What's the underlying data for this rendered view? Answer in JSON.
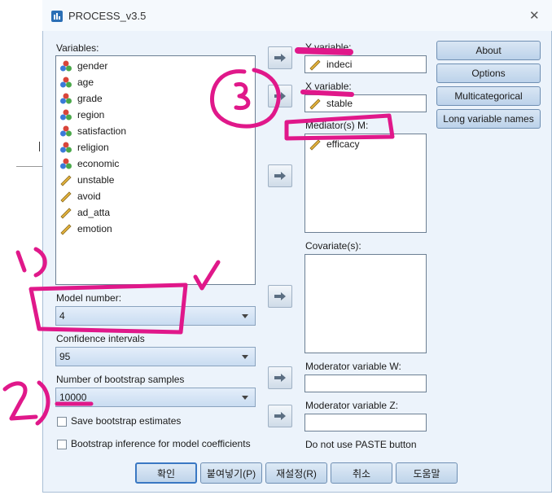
{
  "window": {
    "title": "PROCESS_v3.5",
    "close_glyph": "✕"
  },
  "variables": {
    "label": "Variables:",
    "items": [
      {
        "name": "gender",
        "icon": "nominal-icon"
      },
      {
        "name": "age",
        "icon": "nominal-icon"
      },
      {
        "name": "grade",
        "icon": "nominal-icon"
      },
      {
        "name": "region",
        "icon": "nominal-icon"
      },
      {
        "name": "satisfaction",
        "icon": "nominal-icon"
      },
      {
        "name": "religion",
        "icon": "nominal-icon"
      },
      {
        "name": "economic",
        "icon": "nominal-icon"
      },
      {
        "name": "unstable",
        "icon": "scale-icon"
      },
      {
        "name": "avoid",
        "icon": "scale-icon"
      },
      {
        "name": "ad_atta",
        "icon": "scale-icon"
      },
      {
        "name": "emotion",
        "icon": "scale-icon"
      }
    ]
  },
  "targets": {
    "y_label": "Y variable:",
    "y_value": "indeci",
    "x_label": "X variable:",
    "x_value": "stable",
    "mediator_label": "Mediator(s) M:",
    "mediator_items": [
      "efficacy"
    ],
    "covariate_label": "Covariate(s):",
    "moderator_w_label": "Moderator variable W:",
    "moderator_z_label": "Moderator variable Z:",
    "paste_note": "Do not use PASTE button"
  },
  "options": {
    "model_label": "Model number:",
    "model_value": "4",
    "ci_label": "Confidence intervals",
    "ci_value": "95",
    "bootstrap_label": "Number of bootstrap samples",
    "bootstrap_value": "10000",
    "save_bootstrap": "Save bootstrap estimates",
    "bootstrap_inference": "Bootstrap inference for model coefficients"
  },
  "side_buttons": [
    "About",
    "Options",
    "Multicategorical",
    "Long variable names"
  ],
  "bottom_buttons": {
    "ok": "확인",
    "paste": "붙여넣기(P)",
    "reset": "재설정(R)",
    "cancel": "취소",
    "help": "도움말"
  },
  "annotations": {
    "mark_1": "1)",
    "mark_2": "2)",
    "mark_3": "3)",
    "ink_color": "#e0188a"
  },
  "colors": {
    "window_bg": "#ecf3fb",
    "button_blue": "#c9dcf1",
    "arrow_green": "#3a8fd9"
  }
}
